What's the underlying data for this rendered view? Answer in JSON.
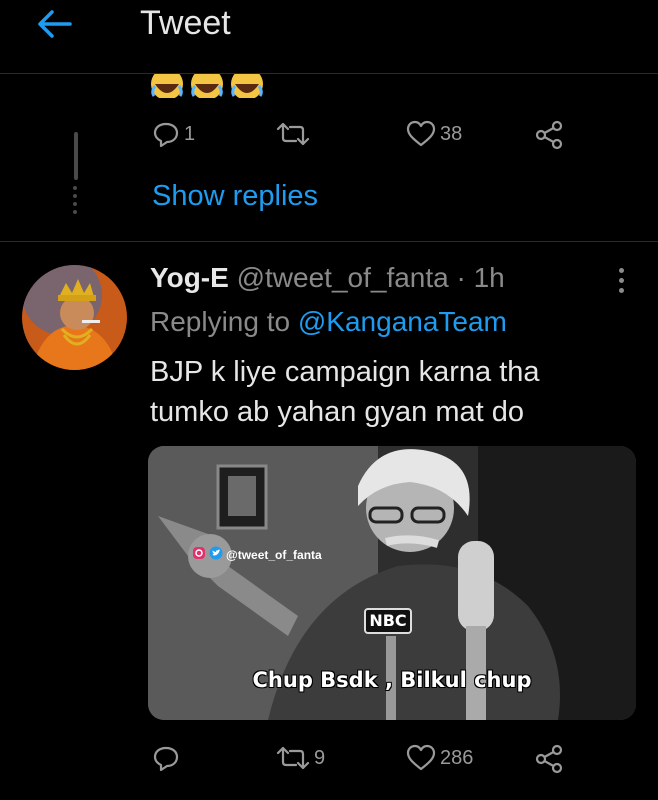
{
  "header": {
    "title": "Tweet"
  },
  "prev_tweet": {
    "reply_count": "1",
    "like_count": "38",
    "show_replies": "Show replies"
  },
  "tweet": {
    "name": "Yog-E",
    "handle": "@tweet_of_fanta",
    "separator": "·",
    "time": "1h",
    "replying_to_label": "Replying to",
    "replying_to": "@KanganaTeam",
    "text_line1": "BJP k liye campaign karna tha",
    "text_line2": "tumko ab yahan gyan mat do",
    "media": {
      "caption": "Chup Bsdk , Bilkul chup",
      "watermark": "@tweet_of_fanta",
      "mic_label": "NBC"
    },
    "retweet_count": "9",
    "like_count": "286"
  },
  "colors": {
    "accent": "#1e9cf0",
    "background": "#000000",
    "muted": "#8a8a8a"
  },
  "icons": [
    "back-arrow-icon",
    "reply-icon",
    "retweet-icon",
    "like-icon",
    "share-icon",
    "more-icon",
    "emoji-icon"
  ]
}
